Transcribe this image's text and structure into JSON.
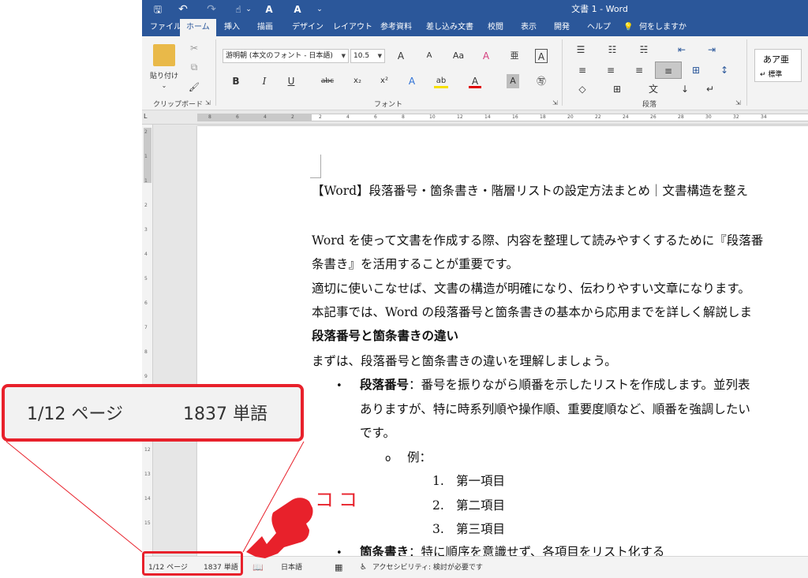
{
  "titlebar": {
    "qat_save": "🖫",
    "qat_undo": "↶",
    "qat_redo": "↷",
    "qat_touch": "☝",
    "qat_dropdown": "⌄",
    "qat_readaloud1": "A",
    "qat_readaloud2": "A",
    "qat_customize": "⌄",
    "doc_title": "文書 1 - Word"
  },
  "tabs": [
    "ファイル",
    "ホーム",
    "挿入",
    "描画",
    "デザイン",
    "レイアウト",
    "参考資料",
    "差し込み文書",
    "校閲",
    "表示",
    "開発",
    "ヘルプ"
  ],
  "tell_me": "何をしますか",
  "tell_me_icon": "💡",
  "ribbon": {
    "clipboard": {
      "paste_label": "貼り付け",
      "paste_arrow": "⌄",
      "cut_icon": "✂",
      "copy_icon": "⧉",
      "format_painter_icon": "🖌",
      "group_label": "クリップボード",
      "launcher": "⇲"
    },
    "font": {
      "font_name": "游明朝 (本文のフォント - 日本語)",
      "font_size": "10.5",
      "grow": "A",
      "shrink": "A",
      "change_case": "Aa",
      "clear_format": "A",
      "phonetic": "亜",
      "char_border": "A",
      "bold": "B",
      "italic": "I",
      "underline": "U",
      "strike": "abc",
      "subscript": "x₂",
      "superscript": "x²",
      "text_effects": "A",
      "highlight": "ab",
      "font_color": "A",
      "char_shading": "A",
      "enclose": "㊢",
      "group_label": "フォント",
      "launcher": "⇲"
    },
    "paragraph": {
      "bullets": "☰",
      "numbering": "☷",
      "multilevel": "☵",
      "decrease_indent": "⇤",
      "increase_indent": "⇥",
      "align_left": "≡",
      "center": "≡",
      "align_right": "≡",
      "justify": "≡",
      "distributed": "⊞",
      "line_spacing": "↕",
      "shading": "◇",
      "borders": "⊞",
      "asian_layout": "文",
      "sort": "↓",
      "show_marks": "↵",
      "group_label": "段落",
      "launcher": "⇲"
    },
    "styles": {
      "style_sample": "あア亜",
      "style_name": "↵ 標準"
    }
  },
  "ruler_numbers": [
    "8",
    "6",
    "4",
    "2",
    "2",
    "4",
    "6",
    "8",
    "10",
    "12",
    "14",
    "16",
    "18",
    "20",
    "22",
    "24",
    "26",
    "28",
    "30",
    "32",
    "34"
  ],
  "ruler_corner": "L",
  "vruler_numbers": [
    "2",
    "1",
    "1",
    "2",
    "3",
    "4",
    "5",
    "6",
    "7",
    "8",
    "9",
    "10",
    "11",
    "12",
    "13",
    "14",
    "15"
  ],
  "document": {
    "title_line": "【Word】段落番号・箇条書き・階層リストの設定方法まとめ｜文書構造を整え",
    "p1a": "Word を使って文書を作成する際、内容を整理して読みやすくするために『段落番",
    "p1b": "条書き』を活用することが重要です。",
    "p2": "適切に使いこなせば、文書の構造が明確になり、伝わりやすい文章になります。",
    "p3": "本記事では、Word の段落番号と箇条書きの基本から応用までを詳しく解説しま",
    "heading": "段落番号と箇条書きの違い",
    "p4": "まずは、段落番号と箇条書きの違いを理解しましょう。",
    "bullet1_term": "段落番号",
    "bullet1_text": "：番号を振りながら順番を示したリストを作成します。並列表",
    "bullet1_line2": "ありますが、特に時系列順や操作順、重要度順など、順番を強調したい",
    "bullet1_line3": "です。",
    "bullet_char": "•",
    "sub_bullet_char": "o",
    "sub_item": "例：",
    "num1": "1.",
    "item1": "第一項目",
    "num2": "2.",
    "item2": "第二項目",
    "num3": "3.",
    "item3": "第三項目",
    "bullet2_term": "箇条書き",
    "bullet2_text": "：特に順序を意識せず、各項目をリスト化する"
  },
  "statusbar": {
    "page": "1/12 ページ",
    "words": "1837 単語",
    "proof_icon": "📖",
    "language": "日本語",
    "macro_icon": "▦",
    "accessibility": "アクセシビリティ: 検討が必要です",
    "accessibility_icon": "♿"
  },
  "zoom_callout": {
    "page": "1/12 ページ",
    "words": "1837 単語"
  },
  "annotation": {
    "label": "ココ",
    "color": "#e8212b"
  },
  "colors": {
    "word_blue": "#2b579a",
    "highlight_red": "#e8212b"
  }
}
